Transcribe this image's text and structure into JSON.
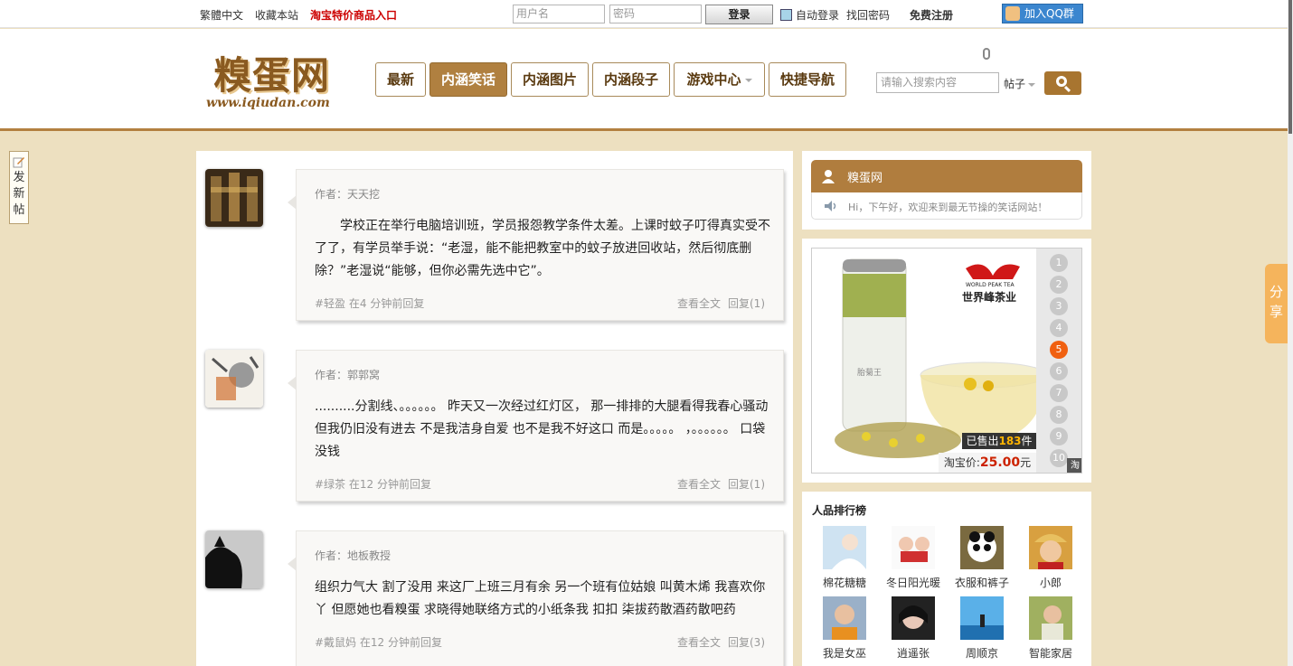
{
  "topbar": {
    "traditional": "繁體中文",
    "favorite": "收藏本站",
    "taobao_entry": "淘宝特价商品入口",
    "username_placeholder": "用户名",
    "password_placeholder": "密码",
    "login": "登录",
    "auto_login": "自动登录",
    "forgot": "找回密码",
    "register": "免费注册",
    "qq_group": "加入QQ群"
  },
  "header": {
    "logo_text": "糗蛋网",
    "logo_url": "www.iqiudan.com",
    "nav": [
      {
        "label": "最新"
      },
      {
        "label": "内涵笑话"
      },
      {
        "label": "内涵图片"
      },
      {
        "label": "内涵段子"
      },
      {
        "label": "游戏中心"
      },
      {
        "label": "快捷导航"
      }
    ],
    "search_placeholder": "请输入搜索内容",
    "search_type": "帖子"
  },
  "colors": {
    "brand": "#b07d3e",
    "background": "#ede0c0",
    "sold_highlight": "#ffb400",
    "price": "#cc2200",
    "ad_active": "#f06010"
  },
  "left_float": {
    "label": "发新帖"
  },
  "share": {
    "label": "分享"
  },
  "posts": [
    {
      "author": "作者：天天挖",
      "text": "　　学校正在举行电脑培训班，学员报怨教学条件太差。上课时蚊子叮得真实受不了了，有学员举手说：“老湿，能不能把教室中的蚊子放进回收站，然后彻底删除？”老湿说“能够，但你必需先选中它”。",
      "meta": "#轻盈 在4 分钟前回复",
      "view": "查看全文",
      "reply": "回复(1)"
    },
    {
      "author": "作者：郭郭窝",
      "text": "..........分割线、。。。。。。 昨天又一次经过红灯区， 那一排排的大腿看得我春心骚动 但我仍旧没有进去 不是我洁身自爱 也不是我不好这口 而是。。。。。 ，。。。。。。 口袋没钱",
      "meta": "#绿茶 在12 分钟前回复",
      "view": "查看全文",
      "reply": "回复(1)"
    },
    {
      "author": "作者：地板教授",
      "text": "组织力气大 割了没用 来这厂上班三月有余 另一个班有位姑娘 叫黄木烯 我喜欢你丫 但愿她也看糗蛋 求晓得她联络方式的小纸条我 扣扣 柒拔药散酒药散吧药",
      "meta": "#戴鼠妈 在12 分钟前回复",
      "view": "查看全文",
      "reply": "回复(3)"
    }
  ],
  "site_box": {
    "name": "糗蛋网",
    "greeting": "Hi，下午好，欢迎来到最无节操的笑话网站！"
  },
  "ad": {
    "numbers": [
      "1",
      "2",
      "3",
      "4",
      "5",
      "6",
      "7",
      "8",
      "9",
      "10"
    ],
    "active": 5,
    "brand_cn": "世界峰茶业",
    "brand_en": "WORLD PEAK TEA",
    "product": "胎菊王",
    "sold_prefix": "已售出",
    "sold_count": "183",
    "sold_suffix": "件",
    "price_label": "淘宝价:",
    "price_value": "25.00",
    "price_unit": "元",
    "tao": "淘"
  },
  "ranking": {
    "title": "人品排行榜",
    "users": [
      {
        "name": "棉花糖糖"
      },
      {
        "name": "冬日阳光暖"
      },
      {
        "name": "衣服和裤子"
      },
      {
        "name": "小郎"
      },
      {
        "name": "我是女巫"
      },
      {
        "name": "逍遥张"
      },
      {
        "name": "周顺京"
      },
      {
        "name": "智能家居"
      }
    ]
  }
}
